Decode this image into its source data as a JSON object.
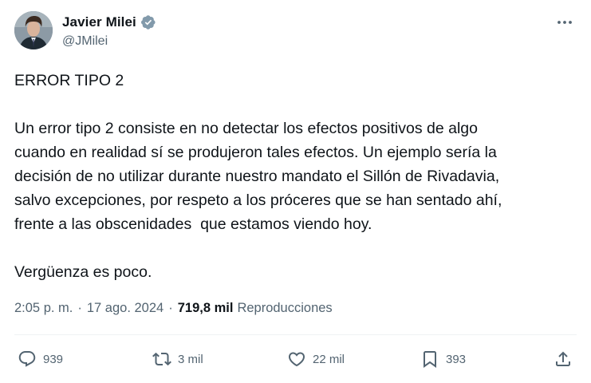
{
  "author": {
    "display_name": "Javier Milei",
    "handle": "@JMilei",
    "verified_icon": "verified-badge-icon",
    "verified_color": "#829aab"
  },
  "tweet": {
    "title": "ERROR TIPO 2",
    "lines": [
      "Un error tipo 2 consiste en no detectar los efectos positivos de algo",
      "cuando en realidad sí se produjeron tales efectos. Un ejemplo sería la",
      "decisión de no utilizar durante nuestro mandato el Sillón de Rivadavia,",
      "salvo excepciones, por respeto a los próceres que se han sentado ahí,",
      "frente a las obscenidades  que estamos viendo hoy."
    ],
    "closing": "Vergüenza es poco."
  },
  "meta": {
    "time": "2:05 p. m.",
    "separator": "·",
    "date": "17 ago. 2024",
    "views_count": "719,8 mil",
    "views_label": "Reproducciones"
  },
  "actions": {
    "replies": {
      "icon": "reply-icon",
      "count": "939"
    },
    "reposts": {
      "icon": "repost-icon",
      "count": "3 mil"
    },
    "likes": {
      "icon": "like-icon",
      "count": "22 mil"
    },
    "bookmarks": {
      "icon": "bookmark-icon",
      "count": "393"
    },
    "share": {
      "icon": "share-icon"
    }
  },
  "colors": {
    "text_primary": "#0f1419",
    "text_secondary": "#536471",
    "divider": "#eff3f4"
  }
}
